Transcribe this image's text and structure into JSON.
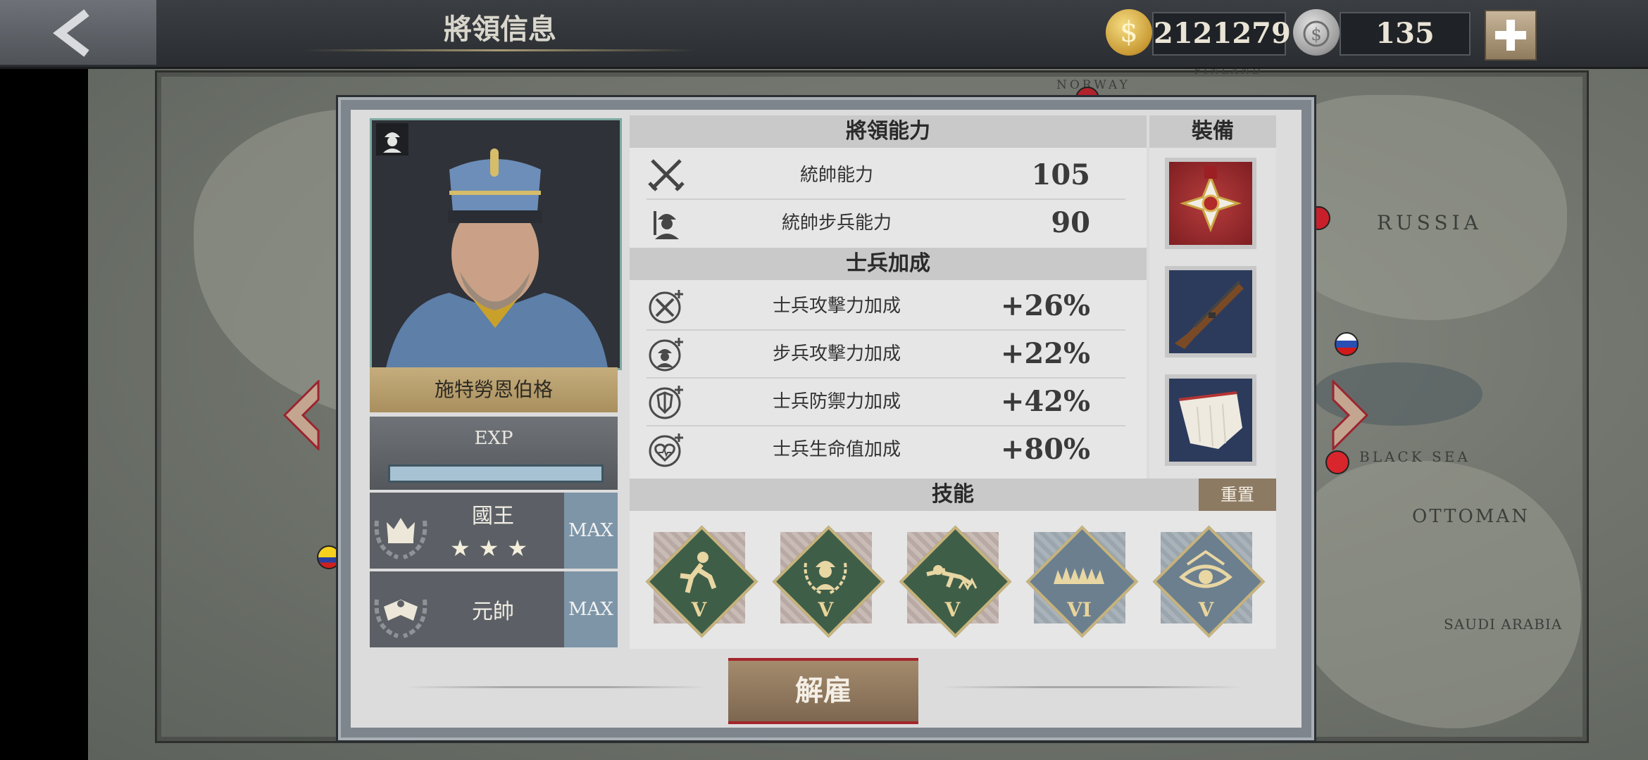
{
  "header": {
    "title": "將領信息",
    "gold": "2121279",
    "medals": "135"
  },
  "map_labels": {
    "norway": "NORWAY",
    "finland": "FINLAND",
    "russia": "RUSSIA",
    "black_sea": "BLACK SEA",
    "ottoman": "OTTOMAN",
    "saudi_arabia": "SAUDI ARABIA"
  },
  "general": {
    "name": "施特勞恩伯格",
    "exp_label": "EXP",
    "exp_fill": 1.0,
    "ranks": [
      {
        "name": "國王",
        "stars": "★★★",
        "max": "MAX"
      },
      {
        "name": "元帥",
        "max": "MAX"
      }
    ]
  },
  "abilities": {
    "header": "將領能力",
    "rows": [
      {
        "label": "統帥能力",
        "value": "105",
        "icon": "crossed-swords-icon"
      },
      {
        "label": "統帥步兵能力",
        "value": "90",
        "icon": "infantry-soldier-icon"
      }
    ]
  },
  "bonus": {
    "header": "士兵加成",
    "rows": [
      {
        "label": "士兵攻擊力加成",
        "value": "+26%",
        "icon": "attack-plus-icon"
      },
      {
        "label": "步兵攻擊力加成",
        "value": "+22%",
        "icon": "infantry-plus-icon"
      },
      {
        "label": "士兵防禦力加成",
        "value": "+42%",
        "icon": "shield-plus-icon"
      },
      {
        "label": "士兵生命值加成",
        "value": "+80%",
        "icon": "heart-plus-icon"
      }
    ]
  },
  "equipment": {
    "header": "裝備",
    "items": [
      "medal-icon",
      "rifle-icon",
      "scarf-icon"
    ]
  },
  "skills": {
    "header": "技能",
    "reset": "重置",
    "items": [
      {
        "level": "V",
        "icon": "running-soldier-icon",
        "color": "#3f5e48"
      },
      {
        "level": "V",
        "icon": "laurel-helmet-icon",
        "color": "#3f5e48"
      },
      {
        "level": "V",
        "icon": "crawling-soldier-icon",
        "color": "#3f5e48"
      },
      {
        "level": "VI",
        "icon": "grass-field-icon",
        "color": "#6b7f8f"
      },
      {
        "level": "V",
        "icon": "eye-icon",
        "color": "#6b7f8f"
      }
    ]
  },
  "dismiss": "解雇",
  "colors": {
    "accent_gold": "#c6b37c",
    "dismiss_red": "#a3262c",
    "skill_green": "#3f5e48",
    "skill_blue": "#6b7f8f"
  }
}
